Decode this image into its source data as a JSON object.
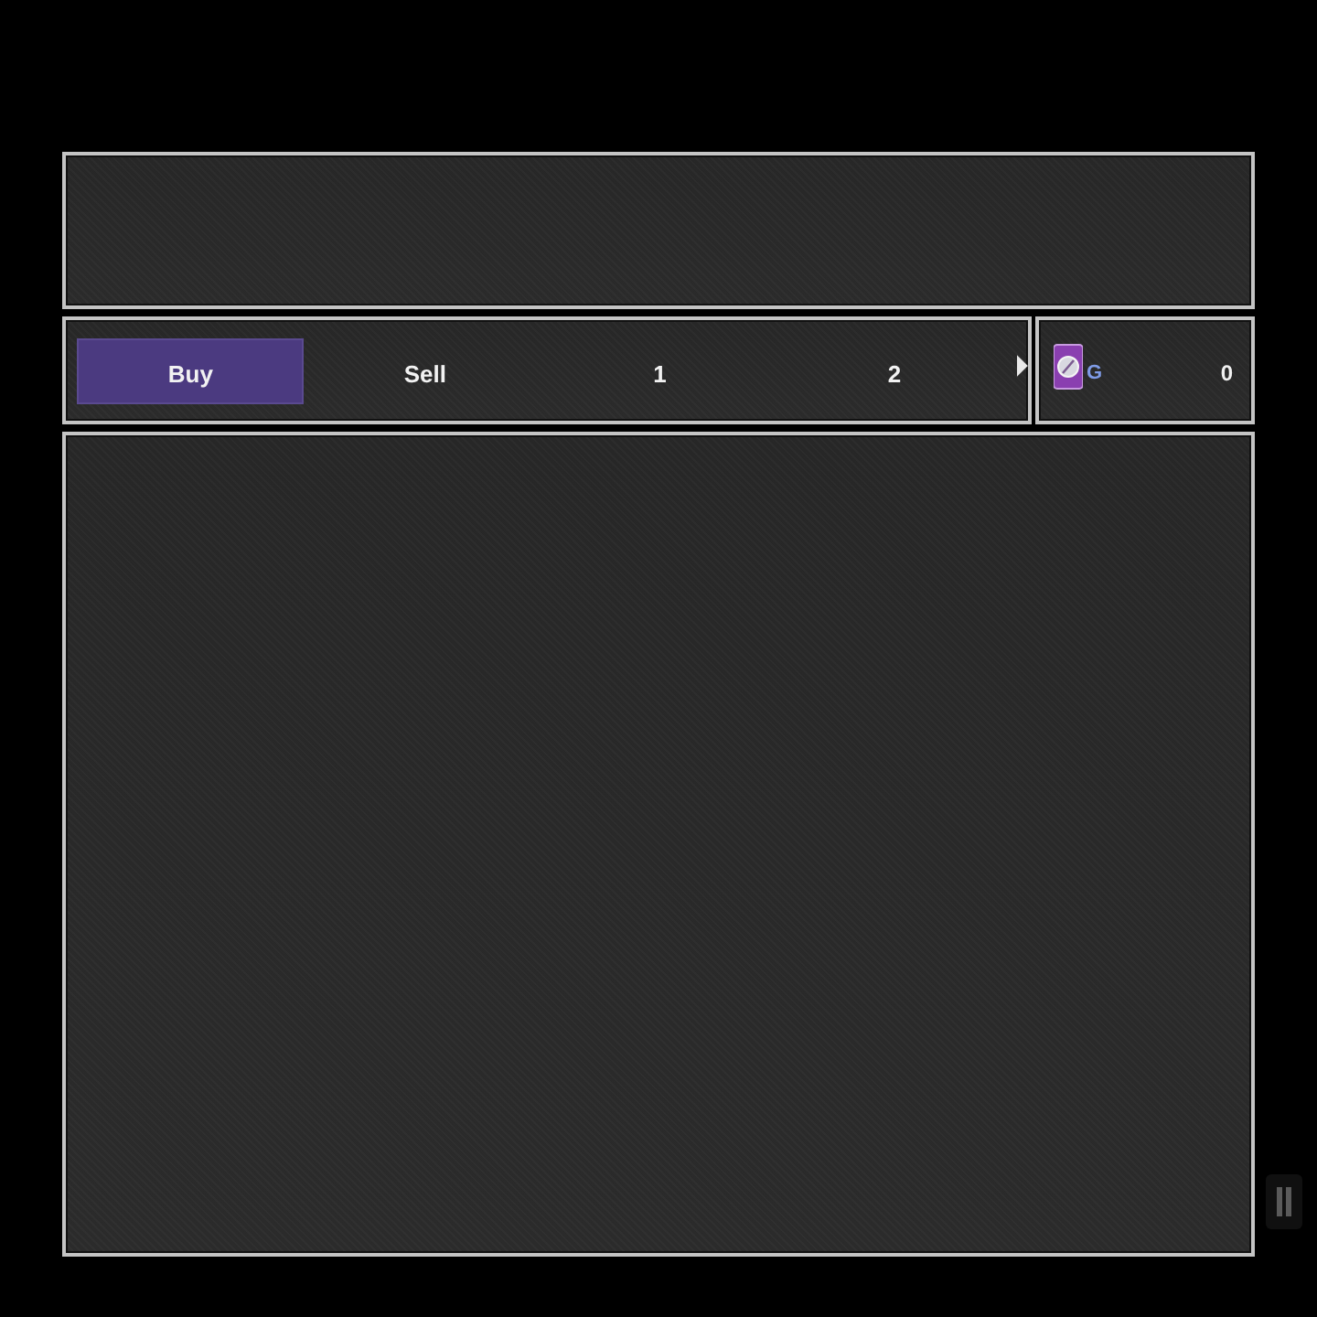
{
  "tabs": [
    {
      "label": "Buy",
      "selected": true
    },
    {
      "label": "Sell",
      "selected": false
    },
    {
      "label": "1",
      "selected": false
    },
    {
      "label": "2",
      "selected": false
    }
  ],
  "currency": {
    "unit": "G",
    "amount": "0"
  }
}
